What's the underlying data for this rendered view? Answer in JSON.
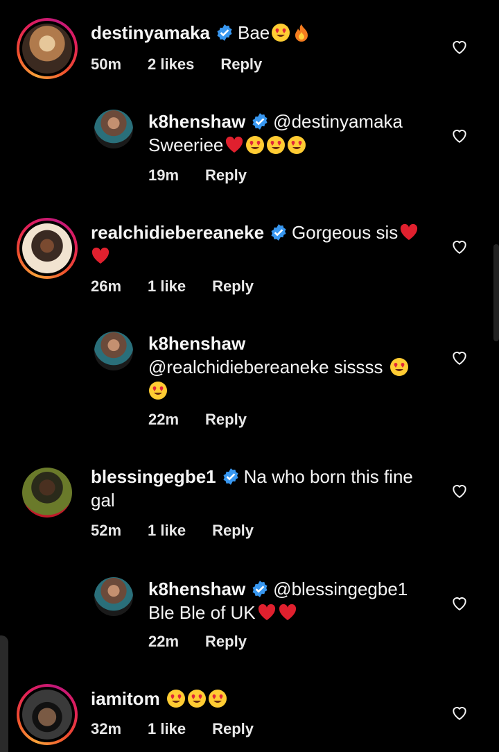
{
  "comments": [
    {
      "user": "destinyamaka",
      "verified": true,
      "text": "Bae",
      "emojis": [
        "heart-eyes",
        "fire"
      ],
      "time": "50m",
      "likes": "2 likes",
      "reply": "Reply",
      "avatar_colors": [
        "#c99b6a",
        "#3b2a20",
        "#e0c090"
      ]
    },
    {
      "user": "k8henshaw",
      "verified": true,
      "text": "@destinyamaka",
      "text2": "Sweeriee",
      "emojis2": [
        "red-heart",
        "heart-eyes",
        "heart-eyes",
        "heart-eyes"
      ],
      "time": "19m",
      "reply": "Reply",
      "avatar_colors": [
        "#6b4a3a",
        "#2a6f7a",
        "#1a1a1a"
      ]
    },
    {
      "user": "realchidiebereaneke",
      "verified": true,
      "text": "Gorgeous sis",
      "emojis": [
        "red-heart"
      ],
      "emojis2": [
        "red-heart"
      ],
      "time": "26m",
      "likes": "1 like",
      "reply": "Reply",
      "avatar_colors": [
        "#3a2a22",
        "#f1e3d0",
        "#cfa060"
      ]
    },
    {
      "user": "k8henshaw",
      "verified": false,
      "text": "@realchidiebereaneke sissss",
      "emojis": [
        "heart-eyes"
      ],
      "emojis2": [
        "heart-eyes"
      ],
      "time": "22m",
      "reply": "Reply",
      "avatar_colors": [
        "#6b4a3a",
        "#2a6f7a",
        "#1a1a1a"
      ]
    },
    {
      "user": "blessingegbe1",
      "verified": true,
      "text": "Na who born this fine",
      "text2": "gal",
      "time": "52m",
      "likes": "1 like",
      "reply": "Reply",
      "avatar_colors": [
        "#6a7a2a",
        "#2a2a1a",
        "#c01a2a"
      ]
    },
    {
      "user": "k8henshaw",
      "verified": true,
      "text": "@blessingegbe1",
      "text2": "Ble Ble of UK",
      "emojis2": [
        "red-heart",
        "red-heart"
      ],
      "time": "22m",
      "reply": "Reply",
      "avatar_colors": [
        "#6b4a3a",
        "#2a6f7a",
        "#1a1a1a"
      ]
    },
    {
      "user": "iamitom",
      "verified": false,
      "text": "",
      "emojis": [
        "heart-eyes",
        "heart-eyes",
        "heart-eyes"
      ],
      "time": "32m",
      "likes": "1 like",
      "reply": "Reply",
      "avatar_colors": [
        "#2a2a2a",
        "#7a5a44",
        "#111111"
      ]
    }
  ],
  "colors": {
    "background": "#000000",
    "text": "#f5f5f5",
    "verified": "#3897f0",
    "story_ring": "#e01e5a"
  }
}
